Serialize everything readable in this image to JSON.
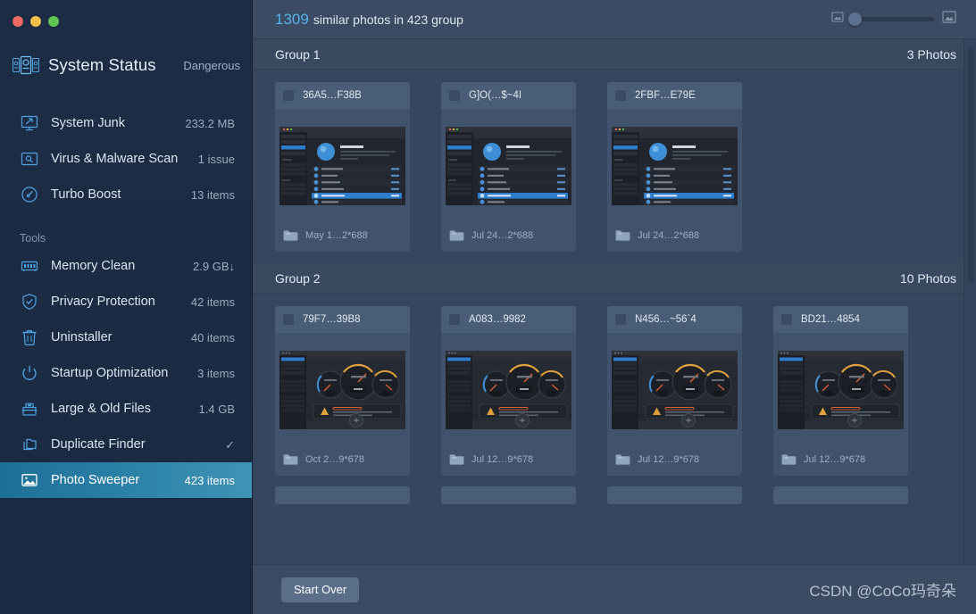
{
  "window": {
    "traffic_lights": [
      "close",
      "minimize",
      "zoom"
    ]
  },
  "sidebar": {
    "status": {
      "icon": "system-status-icon",
      "title": "System Status",
      "value": "Dangerous"
    },
    "main_items": [
      {
        "icon": "system-junk-icon",
        "label": "System Junk",
        "value": "233.2 MB"
      },
      {
        "icon": "virus-scan-icon",
        "label": "Virus & Malware Scan",
        "value": "1 issue"
      },
      {
        "icon": "turbo-boost-icon",
        "label": "Turbo Boost",
        "value": "13 items"
      }
    ],
    "tools_header": "Tools",
    "tools_items": [
      {
        "icon": "memory-clean-icon",
        "label": "Memory Clean",
        "value": "2.9 GB↓",
        "selected": false
      },
      {
        "icon": "privacy-protection-icon",
        "label": "Privacy Protection",
        "value": "42 items",
        "selected": false
      },
      {
        "icon": "uninstaller-icon",
        "label": "Uninstaller",
        "value": "40 items",
        "selected": false
      },
      {
        "icon": "startup-optimization-icon",
        "label": "Startup Optimization",
        "value": "3 items",
        "selected": false
      },
      {
        "icon": "large-old-files-icon",
        "label": "Large & Old Files",
        "value": "1.4 GB",
        "selected": false
      },
      {
        "icon": "duplicate-finder-icon",
        "label": "Duplicate Finder",
        "value": "✓",
        "selected": false
      },
      {
        "icon": "photo-sweeper-icon",
        "label": "Photo Sweeper",
        "value": "423 items",
        "selected": true
      }
    ]
  },
  "topbar": {
    "count": "1309",
    "summary": "similar photos in 423 group",
    "zoom_small_icon": "small-thumbnail-icon",
    "zoom_large_icon": "large-thumbnail-icon",
    "slider_position_percent": 8
  },
  "groups": [
    {
      "name": "Group 1",
      "photo_count": "3 Photos",
      "thumb_style": "app-list",
      "cards": [
        {
          "title": "36A5…F38B",
          "caption": "May 1…2*688",
          "checked": false
        },
        {
          "title": "G]O(…$~4I",
          "caption": "Jul 24…2*688",
          "checked": false
        },
        {
          "title": "2FBF…E79E",
          "caption": "Jul 24…2*688",
          "checked": false
        }
      ]
    },
    {
      "name": "Group 2",
      "photo_count": "10 Photos",
      "thumb_style": "gauges",
      "cards": [
        {
          "title": "79F7…39B8",
          "caption": "Oct 2…9*678",
          "checked": false
        },
        {
          "title": "A083…9982",
          "caption": "Jul 12…9*678",
          "checked": false
        },
        {
          "title": "N456…~56`4",
          "caption": "Jul 12…9*678",
          "checked": false
        },
        {
          "title": "BD21…4854",
          "caption": "Jul 12…9*678",
          "checked": false
        }
      ]
    }
  ],
  "footer": {
    "start_over_label": "Start Over",
    "watermark": "CSDN @CoCo玛奇朵"
  },
  "colors": {
    "accent_blue": "#56b3ea",
    "selected_nav_start": "#1e6f96",
    "selected_nav_end": "#3f93b4",
    "sidebar_bg": "#1c2c45",
    "main_bg": "#35465e",
    "card_bg": "#41536c",
    "card_head_bg": "#4a5d77"
  }
}
